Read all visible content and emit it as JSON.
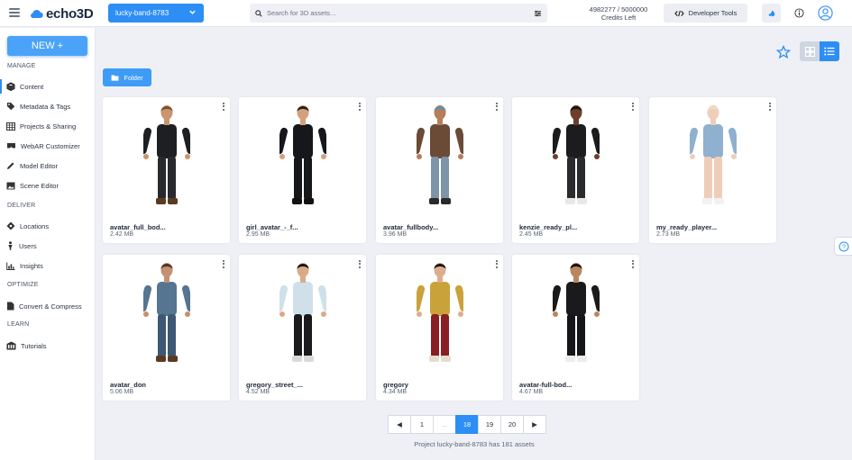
{
  "topbar": {
    "logo_text": "echo3D",
    "project": "lucky-band-8783",
    "search_placeholder": "Search for 3D assets...",
    "credits_value": "4982277 / 5000000",
    "credits_label": "Credits Left",
    "dev_tools": "Developer Tools"
  },
  "sidebar": {
    "new_label": "NEW +",
    "sections": {
      "manage": "MANAGE",
      "deliver": "DELIVER",
      "optimize": "OPTIMIZE",
      "learn": "LEARN"
    },
    "items": [
      {
        "label": "Content",
        "icon": "cube-icon"
      },
      {
        "label": "Metadata & Tags",
        "icon": "tag-icon"
      },
      {
        "label": "Projects & Sharing",
        "icon": "grid-table-icon"
      },
      {
        "label": "WebAR Customizer",
        "icon": "vr-headset-icon"
      },
      {
        "label": "Model Editor",
        "icon": "pencil-icon"
      },
      {
        "label": "Scene Editor",
        "icon": "image-icon"
      },
      {
        "label": "Locations",
        "icon": "diamond-icon"
      },
      {
        "label": "Users",
        "icon": "person-icon"
      },
      {
        "label": "Insights",
        "icon": "chart-icon"
      },
      {
        "label": "Convert & Compress",
        "icon": "file-icon"
      },
      {
        "label": "Tutorials",
        "icon": "building-icon"
      }
    ]
  },
  "toolbar": {
    "folder_label": "Folder"
  },
  "assets": [
    {
      "name": "avatar_full_bod...",
      "size": "2.42 MB",
      "colors": {
        "skin": "#c9946e",
        "hair": "#7a5030",
        "top": "#1d1f22",
        "bottom": "#27292c",
        "shoes": "#5a3a20"
      }
    },
    {
      "name": "girl_avatar_-_f...",
      "size": "2.95 MB",
      "colors": {
        "skin": "#d4a07c",
        "hair": "#2a1c14",
        "top": "#15171a",
        "bottom": "#15171a",
        "shoes": "#111111"
      }
    },
    {
      "name": "avatar_fullbody...",
      "size": "3.96 MB",
      "colors": {
        "skin": "#b57f5c",
        "hair": "#5e8fb0",
        "top": "#6b4a36",
        "bottom": "#7c95a8",
        "shoes": "#2a2a2a"
      }
    },
    {
      "name": "kenzie_ready_pl...",
      "size": "2.45 MB",
      "colors": {
        "skin": "#6b3f2a",
        "hair": "#1a1212",
        "top": "#1c1c1e",
        "bottom": "#2a2b2e",
        "shoes": "#e8e8e8"
      }
    },
    {
      "name": "my_ready_player...",
      "size": "2.73 MB",
      "colors": {
        "skin": "#f0cdb8",
        "hair": "#e8dcc4",
        "top": "#8fb0cf",
        "bottom": "#f0cdb8",
        "shoes": "#f2f2f2"
      }
    },
    {
      "name": "avatar_don",
      "size": "5.06 MB",
      "colors": {
        "skin": "#c39070",
        "hair": "#4e3424",
        "top": "#557590",
        "bottom": "#3c5875",
        "shoes": "#5a3a22"
      }
    },
    {
      "name": "gregory_street_...",
      "size": "4.52 MB",
      "colors": {
        "skin": "#d8ab88",
        "hair": "#151515",
        "top": "#cfe0ea",
        "bottom": "#1a1a1c",
        "shoes": "#d9d9d9"
      }
    },
    {
      "name": "gregory",
      "size": "4.34 MB",
      "colors": {
        "skin": "#dcae8c",
        "hair": "#151515",
        "top": "#c9a23a",
        "bottom": "#8a1e22",
        "shoes": "#e3ddd0"
      }
    },
    {
      "name": "avatar-full-bod...",
      "size": "4.67 MB",
      "colors": {
        "skin": "#b98660",
        "hair": "#161010",
        "top": "#1a1a1c",
        "bottom": "#15161a",
        "shoes": "#ececec"
      }
    }
  ],
  "pagination": {
    "prev": "◀",
    "pages": [
      "1",
      "...",
      "18",
      "19",
      "20"
    ],
    "current": "18",
    "next": "▶"
  },
  "footer": "Project lucky-band-8783 has 181 assets",
  "accent_color": "#2d8ef5"
}
